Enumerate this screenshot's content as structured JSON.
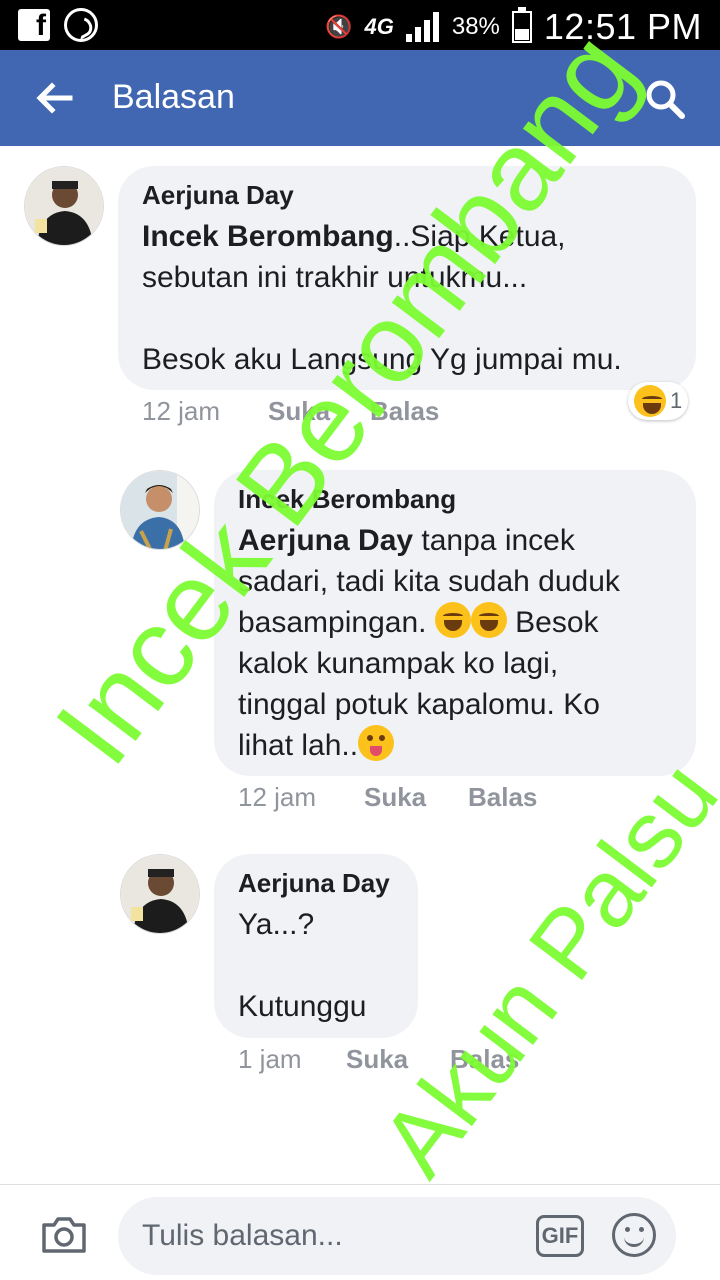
{
  "status_bar": {
    "network": "4G",
    "battery": "38%",
    "battery_level": 0.38,
    "time": "12:51 PM",
    "icons": [
      "facebook-icon",
      "whatsapp-icon",
      "mute-icon",
      "signal-icon",
      "battery-icon"
    ]
  },
  "app_bar": {
    "title": "Balasan",
    "back_icon": "arrow-left-icon",
    "search_icon": "search-icon",
    "background": "#4267b2"
  },
  "comments": [
    {
      "author": "Aerjuna Day",
      "mention": "Incek Berombang",
      "text": "..Siap Ketua,\nsebutan ini trakhir untukmu...\n\nBesok aku Langsung Yg jumpai mu.",
      "time": "12 jam",
      "like": "Suka",
      "reply": "Balas",
      "reaction_count": "1"
    },
    {
      "author": "Incek Berombang",
      "mention": "Aerjuna Day",
      "text_1": " tanpa incek\nsadari, tadi kita sudah duduk\nbasampingan. ",
      "text_2": " Besok\nkalok kunampak ko lagi,\ntinggal potuk kapalomu. Ko\nlihat lah..",
      "time": "12 jam",
      "like": "Suka",
      "reply": "Balas"
    },
    {
      "author": "Aerjuna Day",
      "text": "Ya...?\n\nKutunggu",
      "time": "1 jam",
      "like": "Suka",
      "reply": "Balas"
    }
  ],
  "composer": {
    "placeholder": "Tulis balasan...",
    "gif_label": "GIF",
    "camera_icon": "camera-icon",
    "emoji_icon": "smiley-icon"
  },
  "watermarks": {
    "primary": "Incek Berombang",
    "secondary": "Akun Palsu",
    "color": "#7cfc32"
  }
}
